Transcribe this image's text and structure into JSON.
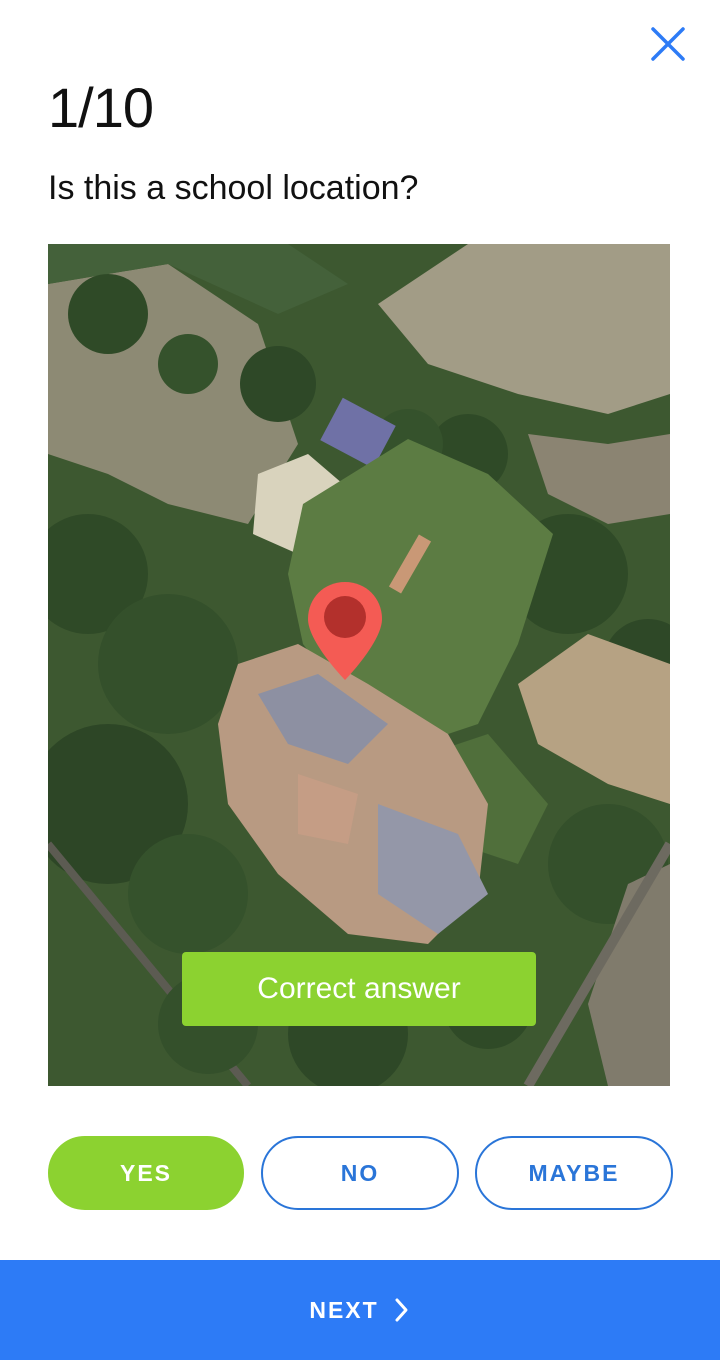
{
  "header": {
    "progress": "1/10",
    "close_icon": "close-icon",
    "accent_color": "#2d7bf6"
  },
  "question": {
    "text": "Is this a school location?"
  },
  "map": {
    "type": "satellite-image",
    "pin_icon": "map-pin-icon",
    "pin_color": "#f45b54",
    "feedback_label": "Correct answer",
    "feedback_color": "#8cd230"
  },
  "answers": {
    "yes_label": "YES",
    "no_label": "NO",
    "maybe_label": "MAYBE",
    "selected": "YES"
  },
  "footer": {
    "next_label": "NEXT",
    "next_icon": "chevron-right-icon"
  }
}
